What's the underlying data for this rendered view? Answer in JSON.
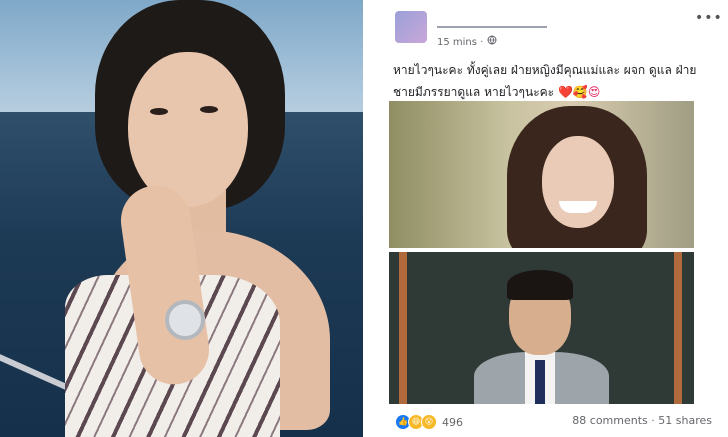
{
  "post": {
    "time": "15 mins ·",
    "text": "หายไวๆนะคะ ทั้งคู่เลย ฝ่ายหญิงมีคุณแม่และ ผจก ดูแล ฝ่ายชายมีภรรยาดูแล หายไวๆนะคะ",
    "emojis": "❤️🥰😍",
    "reactions_count": "496",
    "comments": "88 comments",
    "shares": "51 shares",
    "separator": " · "
  },
  "icons": {
    "globe": "globe-icon",
    "more": "more-options-icon",
    "like": "like-reaction-icon",
    "haha": "haha-reaction-icon",
    "wow": "wow-reaction-icon"
  },
  "colors": {
    "accent": "#1877f2",
    "secondary_text": "#65676b"
  }
}
